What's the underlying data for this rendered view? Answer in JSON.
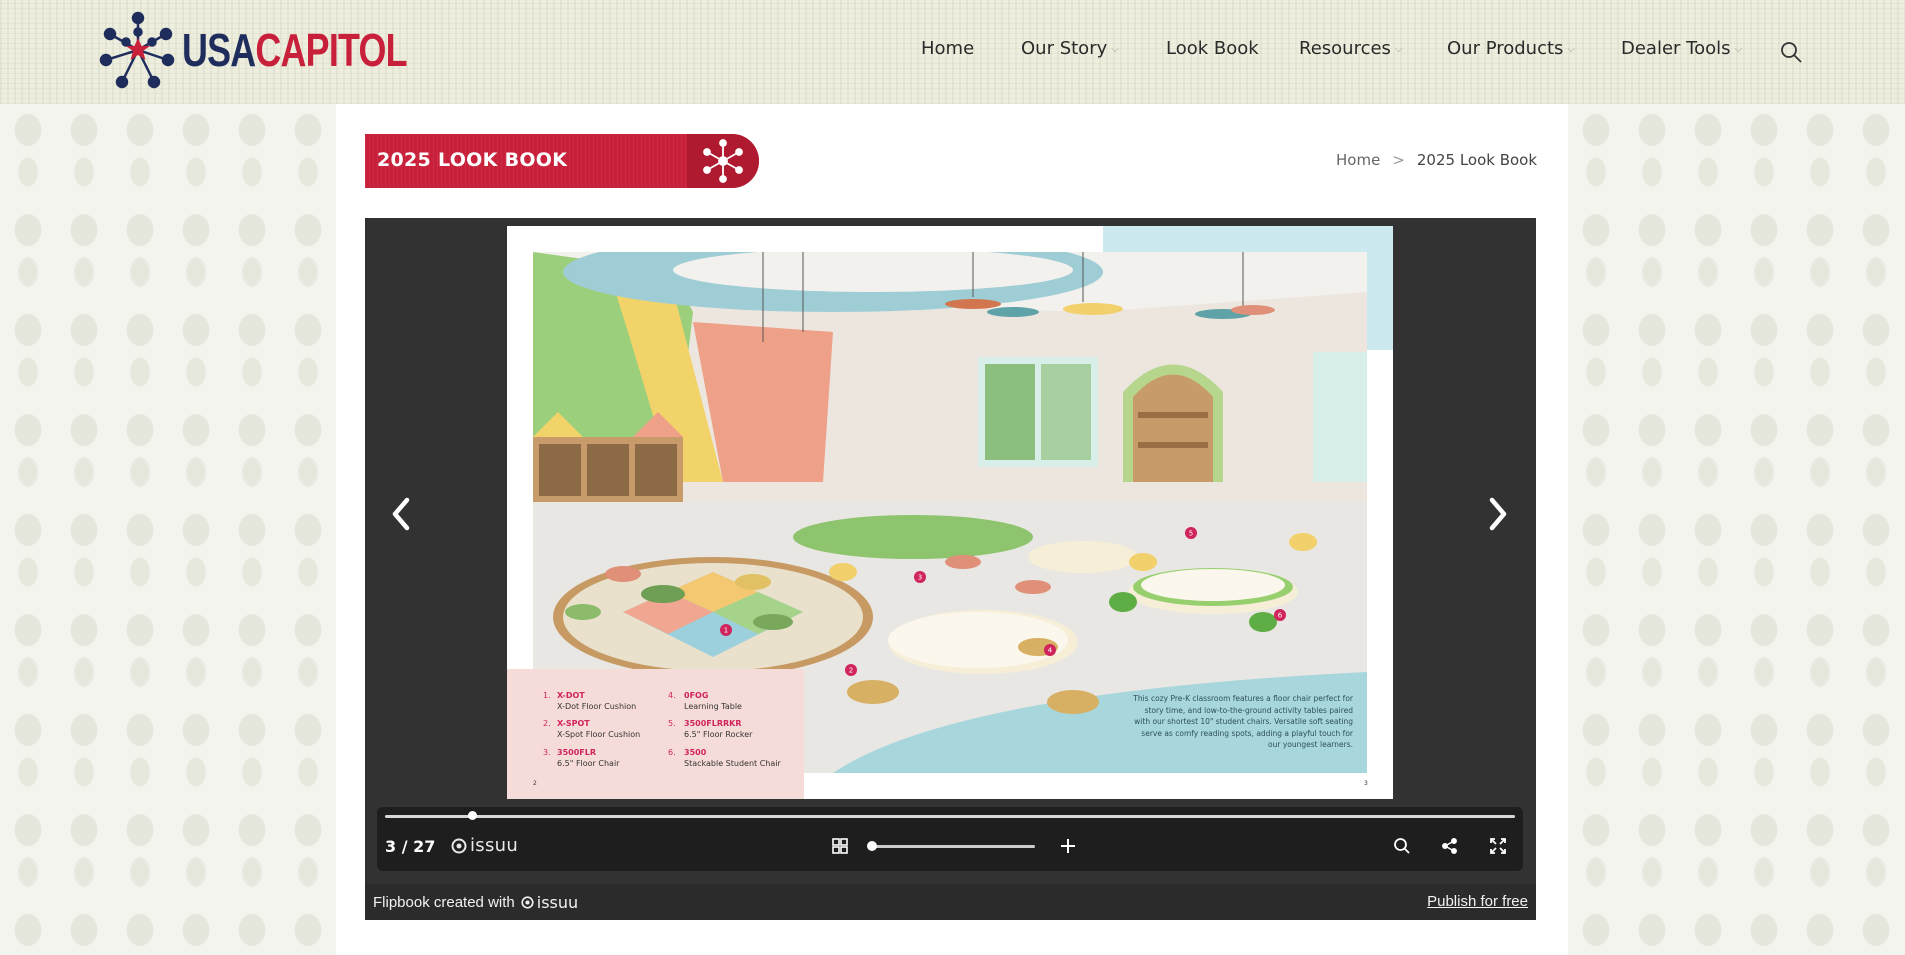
{
  "brand": {
    "name_part1": "USA",
    "name_part2": "CAPITOL",
    "navy": "#1f2d5c",
    "red": "#c8203a"
  },
  "nav": {
    "items": [
      {
        "label": "Home",
        "has_dropdown": false
      },
      {
        "label": "Our Story",
        "has_dropdown": true
      },
      {
        "label": "Look Book",
        "has_dropdown": false
      },
      {
        "label": "Resources",
        "has_dropdown": true
      },
      {
        "label": "Our Products",
        "has_dropdown": true
      },
      {
        "label": "Dealer Tools",
        "has_dropdown": true
      }
    ],
    "dropdown_glyph": "⌵",
    "search_icon": "search-icon"
  },
  "banner": {
    "title": "2025 LOOK BOOK",
    "icon": "network-logo-icon"
  },
  "breadcrumb": {
    "home": "Home",
    "separator": ">",
    "current": "2025 Look Book"
  },
  "flipbook": {
    "legend": [
      {
        "num": "1.",
        "code": "X-DOT",
        "desc": "X-Dot Floor Cushion"
      },
      {
        "num": "2.",
        "code": "X-SPOT",
        "desc": "X-Spot Floor Cushion"
      },
      {
        "num": "3.",
        "code": "3500FLR",
        "desc": "6.5\" Floor Chair"
      },
      {
        "num": "4.",
        "code": "0FOG",
        "desc": "Learning Table"
      },
      {
        "num": "5.",
        "code": "3500FLRRKR",
        "desc": "6.5\" Floor Rocker"
      },
      {
        "num": "6.",
        "code": "3500",
        "desc": "Stackable Student Chair"
      }
    ],
    "left_page_number": "2",
    "right_page_number": "3",
    "caption": "This cozy Pre-K classroom features a floor chair perfect for story time, and low-to-the-ground activity tables paired with our shortest 10\" student chairs. Versatile soft seating serve as comfy reading spots, adding a playful touch for our youngest learners.",
    "callouts": [
      "1",
      "2",
      "3",
      "4",
      "5",
      "6"
    ],
    "prev_icon": "chevron-left-icon",
    "next_icon": "chevron-right-icon",
    "progress": 0.077,
    "zoom": 0.0
  },
  "controls": {
    "page_count": "3 / 27",
    "issuu_wordmark": "issuu",
    "grid_icon": "grid-icon",
    "plus_icon": "plus-icon",
    "search_icon": "search-icon",
    "share_icon": "share-icon",
    "fullscreen_icon": "fullscreen-icon"
  },
  "footer": {
    "created_with": "Flipbook created with",
    "issuu_wordmark": "issuu",
    "publish_link": "Publish for free"
  }
}
